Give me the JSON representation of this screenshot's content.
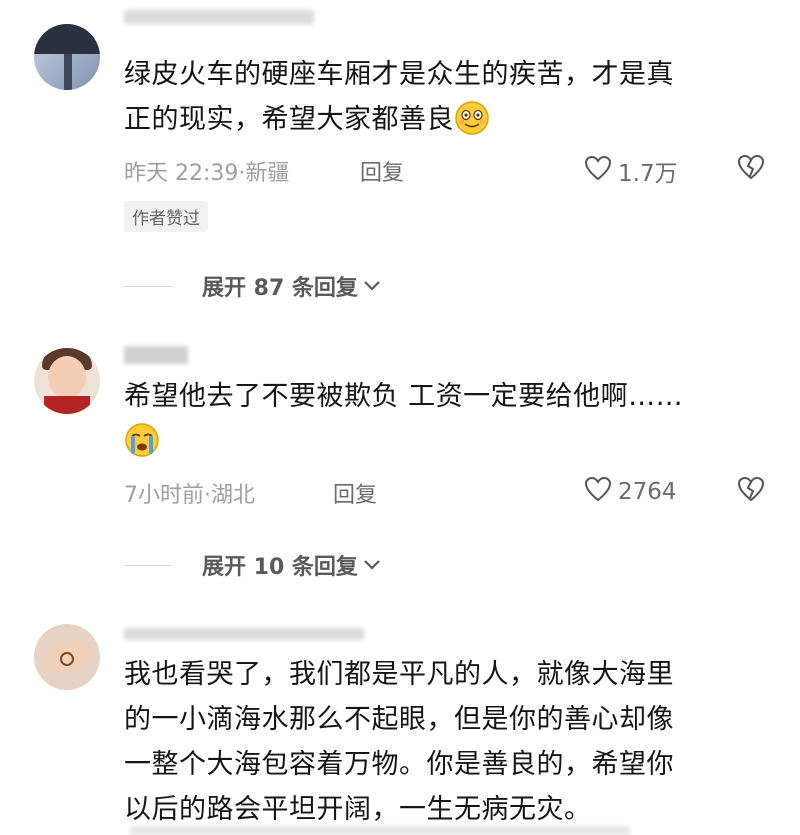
{
  "comments": [
    {
      "text_line1": "绿皮火车的硬座车厢才是众生的疾苦，才是真",
      "text_line2": "正的现实，希望大家都善良",
      "emoji": "smiling-face-emoji",
      "time": "昨天 22:39",
      "sep": "·",
      "location": "新疆",
      "reply_label": "回复",
      "likes": "1.7万",
      "badge": "作者赞过",
      "expand_label": "展开 87 条回复"
    },
    {
      "text_line1": "希望他去了不要被欺负 工资一定要给他啊……",
      "emoji": "crying-face-emoji",
      "time": "7小时前",
      "sep": "·",
      "location": "湖北",
      "reply_label": "回复",
      "likes": "2764",
      "expand_label": "展开 10 条回复"
    },
    {
      "text_line1": "我也看哭了，我们都是平凡的人，就像大海里",
      "text_line2": "的一小滴海水那么不起眼，但是你的善心却像",
      "text_line3": "一整个大海包容着万物。你是善良的，希望你",
      "text_line4": "以后的路会平坦开阔，一生无病无灾。"
    }
  ],
  "colors": {
    "text": "#161616",
    "meta": "#a0a0a0",
    "badge_bg": "#f1f1f1",
    "emoji_yellow": "#ffcc33"
  }
}
